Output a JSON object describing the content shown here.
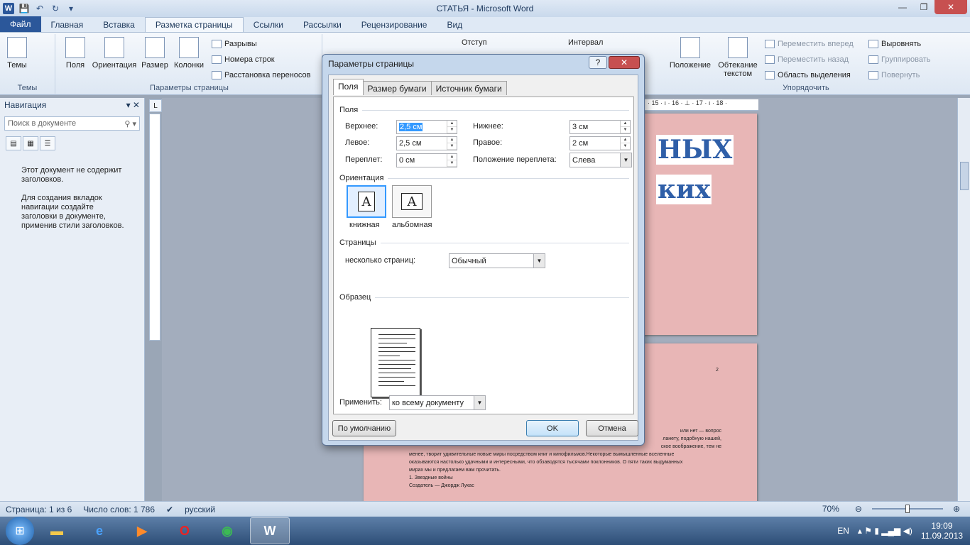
{
  "window": {
    "title": "СТАТЬЯ - Microsoft Word"
  },
  "qat": {
    "logo": "W",
    "save_icon": "💾",
    "undo_icon": "↶",
    "redo_icon": "↻",
    "more_icon": "▾"
  },
  "winctl": {
    "minimize": "—",
    "maximize": "❐",
    "close": "✕"
  },
  "tabs": [
    "Файл",
    "Главная",
    "Вставка",
    "Разметка страницы",
    "Ссылки",
    "Рассылки",
    "Рецензирование",
    "Вид"
  ],
  "ribbon": {
    "themes_group": "Темы",
    "themes_btn": "Темы",
    "page_setup_group": "Параметры страницы",
    "fields_btn": "Поля",
    "orientation_btn": "Ориентация",
    "size_btn": "Размер",
    "columns_btn": "Колонки",
    "breaks": "Разрывы",
    "line_numbers": "Номера строк",
    "hyphenation": "Расстановка переносов",
    "indent_label": "Отступ",
    "interval_label": "Интервал",
    "arrange_group": "Упорядочить",
    "position_btn": "Положение",
    "wrap_btn_line1": "Обтекание",
    "wrap_btn_line2": "текстом",
    "bring_forward": "Переместить вперед",
    "send_backward": "Переместить назад",
    "selection_pane": "Область выделения",
    "align": "Выровнять",
    "group": "Группировать",
    "rotate": "Повернуть"
  },
  "nav": {
    "title": "Навигация",
    "search_placeholder": "Поиск в документе",
    "msg1": "Этот документ не содержит заголовков.",
    "msg2": "Для создания вкладок навигации создайте заголовки в документе, применив стили заголовков."
  },
  "doc": {
    "word1": "НЫХ",
    "word2": "ких",
    "page_number": "2",
    "ruler_ticks": "· 15 · ı · 16 · ⊥ · 17 · ı · 18 ·",
    "text_lines": [
      "или нет — вопрос",
      "ланету, подобную нашей,",
      "ское воображение, тем не",
      "менее, творит удивительные новые миры посредством книг и кинофильмов.Некоторые вымышленные вселенные",
      "оказываются настолько удачными и интересными, что обзаводятся тысячами поклонников. О пяти таких выдуманных",
      "мирах мы и предлагаем вам прочитать.",
      "",
      "1. Звездные войны",
      "Создатель — Джордж Лукас"
    ]
  },
  "dialog": {
    "title": "Параметры страницы",
    "help": "?",
    "close": "✕",
    "tabs": [
      "Поля",
      "Размер бумаги",
      "Источник бумаги"
    ],
    "margins_section": "Поля",
    "top_label": "Верхнее:",
    "top_value": "2,5 см",
    "bottom_label": "Нижнее:",
    "bottom_value": "3 см",
    "left_label": "Левое:",
    "left_value": "2,5 см",
    "right_label": "Правое:",
    "right_value": "2 см",
    "gutter_label": "Переплет:",
    "gutter_value": "0 см",
    "gutter_pos_label": "Положение переплета:",
    "gutter_pos_value": "Слева",
    "orientation_section": "Ориентация",
    "portrait": "книжная",
    "landscape": "альбомная",
    "glyph": "A",
    "pages_section": "Страницы",
    "multiple_pages_label": "несколько страниц:",
    "multiple_pages_value": "Обычный",
    "preview_section": "Образец",
    "apply_label": "Применить:",
    "apply_value": "ко всему документу",
    "default_btn": "По умолчанию",
    "ok_btn": "OK",
    "cancel_btn": "Отмена"
  },
  "status": {
    "page": "Страница: 1 из 6",
    "words": "Число слов: 1 786",
    "lang": "русский",
    "zoom": "70%",
    "zoom_level": 0.5
  },
  "taskbar": {
    "lang": "EN",
    "time": "19:09",
    "date": "11.09.2013"
  }
}
